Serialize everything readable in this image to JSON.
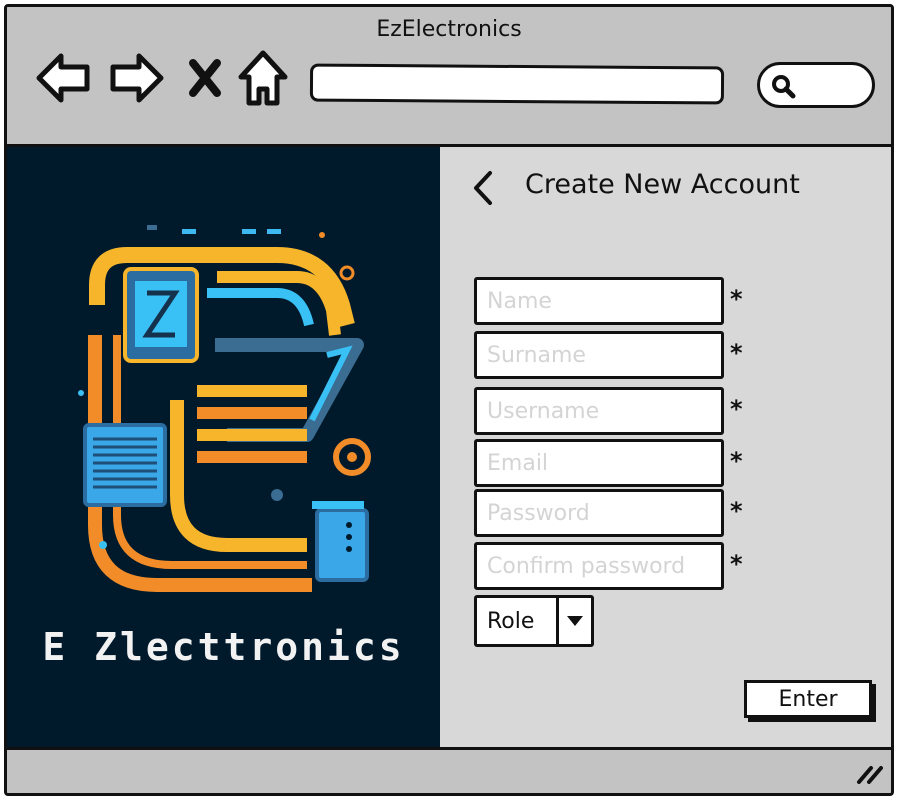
{
  "window": {
    "title": "EzElectronics"
  },
  "browser": {
    "back_icon": "back-arrow-icon",
    "forward_icon": "forward-arrow-icon",
    "stop_icon": "close-icon",
    "home_icon": "home-icon",
    "address_value": "",
    "search_icon": "search-icon"
  },
  "brand": {
    "logo_text": "E Zlecttronics",
    "background_color": "#001a2c"
  },
  "form": {
    "title": "Create New Account",
    "back_icon": "chevron-left-icon",
    "fields": [
      {
        "placeholder": "Name",
        "required_mark": "*"
      },
      {
        "placeholder": "Surname",
        "required_mark": "*"
      },
      {
        "placeholder": "Username",
        "required_mark": "*"
      },
      {
        "placeholder": "Email",
        "required_mark": "*"
      },
      {
        "placeholder": "Password",
        "required_mark": "*"
      },
      {
        "placeholder": "Confirm password",
        "required_mark": "*"
      }
    ],
    "role": {
      "selected": "Role",
      "arrow_icon": "triangle-down-icon"
    },
    "submit_label": "Enter"
  },
  "statusbar": {
    "resize_icon": "resize-grip-icon"
  }
}
